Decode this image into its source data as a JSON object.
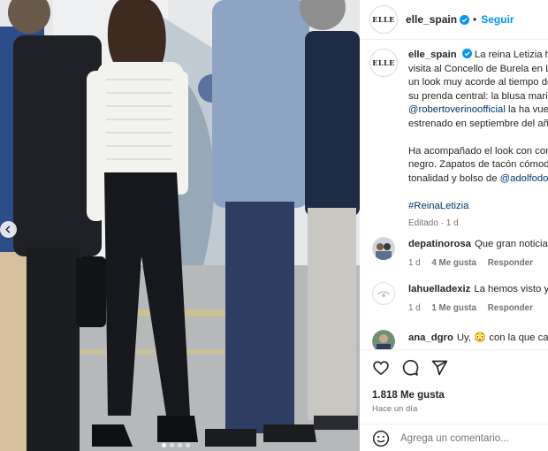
{
  "post": {
    "username": "elle_spain",
    "avatar_logo": "ELLE",
    "follow_label": "Seguir",
    "separator": "•",
    "caption_lines": [
      "La reina Letizia ha a",
      "visita al Concello de Burela en Lu",
      "un look muy acorde al tiempo de",
      "su prenda central: la blusa marin"
    ],
    "caption_mention_1": "@robertoverinoofficial",
    "caption_after_mention_1": " la ha vuelt",
    "caption_line_6": "estrenado en septiembre del año",
    "caption_line_7": "Ha acompañado el look con con",
    "caption_line_8": "negro. Zapatos de tacón cómodo",
    "caption_line_9_pre": "tonalidad y bolso de ",
    "caption_mention_2": "@adolfodo",
    "hashtag": "#ReinaLetizia",
    "edited": "Editado · 1 d"
  },
  "comments": [
    {
      "user": "depatinorosa",
      "text": "Que gran noticia! ",
      "age": "1 d",
      "likes": "4 Me gusta",
      "reply": "Responder"
    },
    {
      "user": "lahuelladexiz",
      "text": "La hemos visto y n",
      "age": "1 d",
      "likes": "1 Me gusta",
      "reply": "Responder"
    },
    {
      "user": "ana_dgro",
      "text": "Uy, ",
      "text_after": " con la que cae",
      "emoji": "😳"
    }
  ],
  "actions": {
    "likes_label": "1.818 Me gusta",
    "time_label": "Hace un día",
    "comment_placeholder": "Agrega un comentario..."
  },
  "colors": {
    "link": "#0095f6",
    "mention": "#00376b",
    "muted": "#737373"
  },
  "icons": [
    "chevron-left-icon",
    "verified-icon",
    "heart-icon",
    "comment-icon",
    "share-icon",
    "emoji-icon"
  ]
}
